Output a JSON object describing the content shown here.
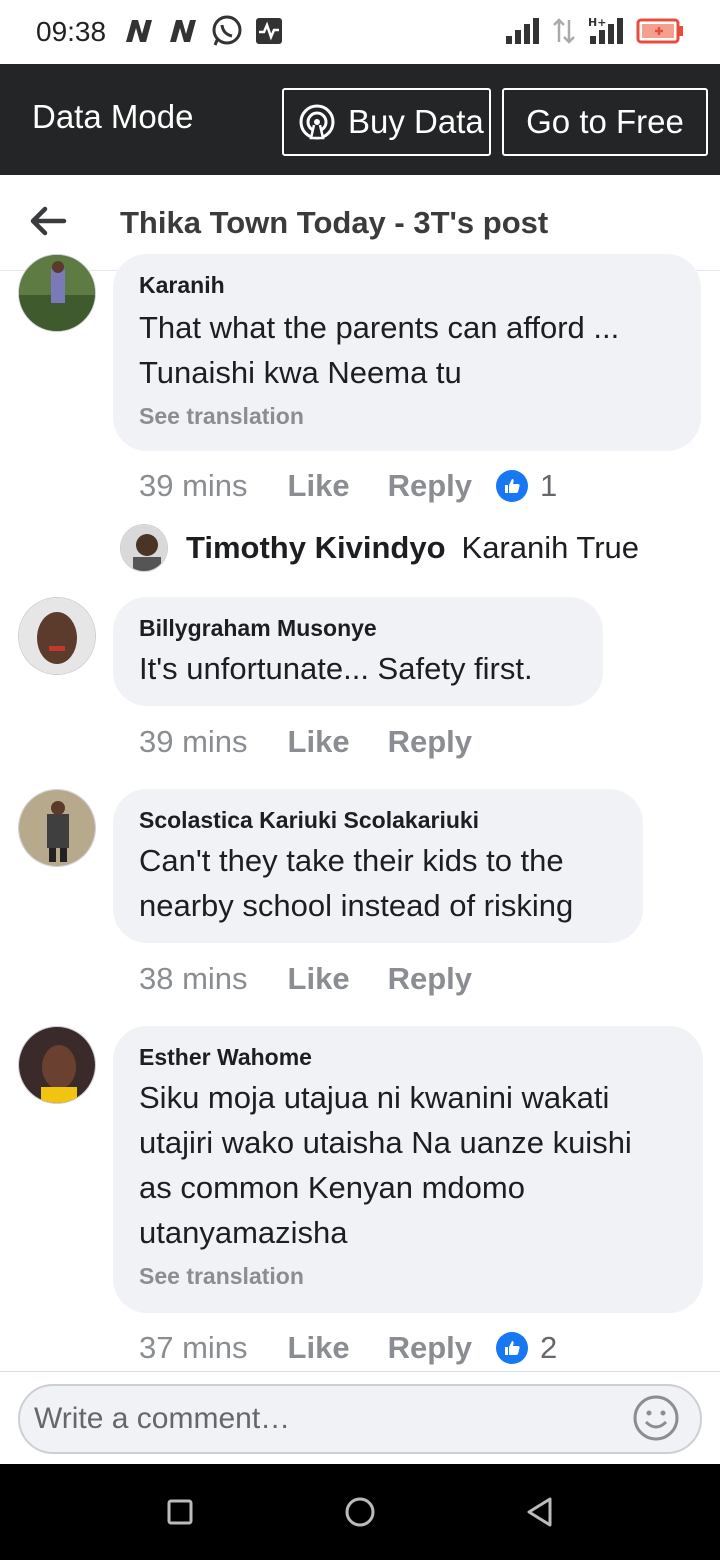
{
  "status_bar": {
    "time": "09:38",
    "left_icons": [
      "netflix-icon",
      "netflix-icon",
      "whatsapp-icon",
      "activity-icon"
    ],
    "right_icons": [
      "signal-icon",
      "data-transfer-icon",
      "hplus-signal-icon",
      "battery-icon"
    ]
  },
  "data_bar": {
    "mode_label": "Data Mode",
    "buy_data_label": "Buy Data",
    "go_free_label": "Go to Free"
  },
  "header": {
    "title": "Thika Town Today - 3T's post"
  },
  "comments": [
    {
      "author": "Karanih",
      "lines": [
        "That what the parents  can afford ...",
        "Tunaishi kwa Neema tu"
      ],
      "see_translation": "See translation",
      "time": "39 mins",
      "like": "Like",
      "reply": "Reply",
      "reactions": "1"
    },
    {
      "author": "Billygraham Musonye",
      "lines": [
        "It's unfortunate... Safety first."
      ],
      "time": "39 mins",
      "like": "Like",
      "reply": "Reply"
    },
    {
      "author": "Scolastica Kariuki Scolakariuki",
      "lines": [
        "Can't they take their kids to the",
        "nearby school instead of risking"
      ],
      "time": "38 mins",
      "like": "Like",
      "reply": "Reply"
    },
    {
      "author": "Esther Wahome",
      "lines": [
        "Siku moja utajua ni kwanini wakati",
        "utajiri wako utaisha Na uanze kuishi",
        "as common Kenyan mdomo",
        "utanyamazisha"
      ],
      "see_translation": "See translation",
      "time": "37 mins",
      "like": "Like",
      "reply": "Reply",
      "reactions": "2"
    }
  ],
  "reply_preview": {
    "author": "Timothy Kivindyo",
    "text": "Karanih True"
  },
  "composer": {
    "placeholder": "Write a comment…"
  },
  "colors": {
    "accent": "#1877f2",
    "bubble": "#f0f2f5",
    "data_bar": "#242526"
  }
}
